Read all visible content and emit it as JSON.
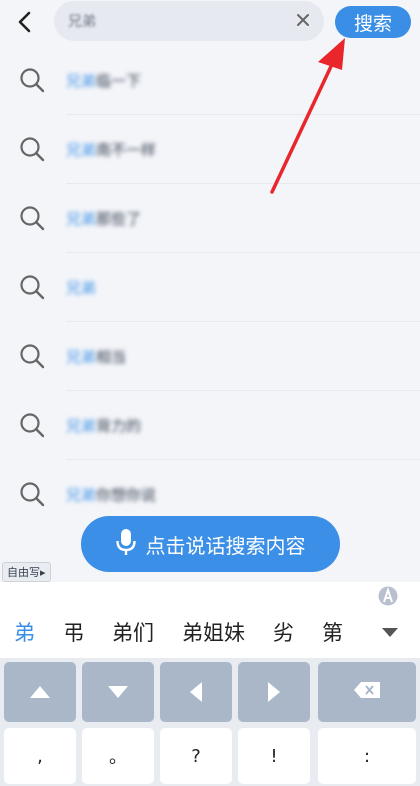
{
  "search": {
    "query": "兄弟",
    "button_label": "搜索"
  },
  "suggestions": [
    {
      "highlight": "兄弟",
      "rest": "临一下"
    },
    {
      "highlight": "兄弟",
      "rest": "南不一样"
    },
    {
      "highlight": "兄弟",
      "rest": "那些了"
    },
    {
      "highlight": "兄弟",
      "rest": ""
    },
    {
      "highlight": "兄弟",
      "rest": "相当"
    },
    {
      "highlight": "兄弟",
      "rest": "背力的"
    },
    {
      "highlight": "兄弟",
      "rest": "你想你说"
    }
  ],
  "voice": {
    "label": "点击说话搜索内容"
  },
  "handwrite": {
    "label": "自由写▸"
  },
  "keyboard": {
    "candidates": [
      "弟",
      "弔",
      "弟们",
      "弟姐妹",
      "劣",
      "第"
    ],
    "row2": [
      ",",
      "。",
      "?",
      "!",
      ":"
    ]
  },
  "colors": {
    "accent": "#3a8ee6",
    "arrow": "#e8262c",
    "key_dark": "#a9b7c9"
  }
}
